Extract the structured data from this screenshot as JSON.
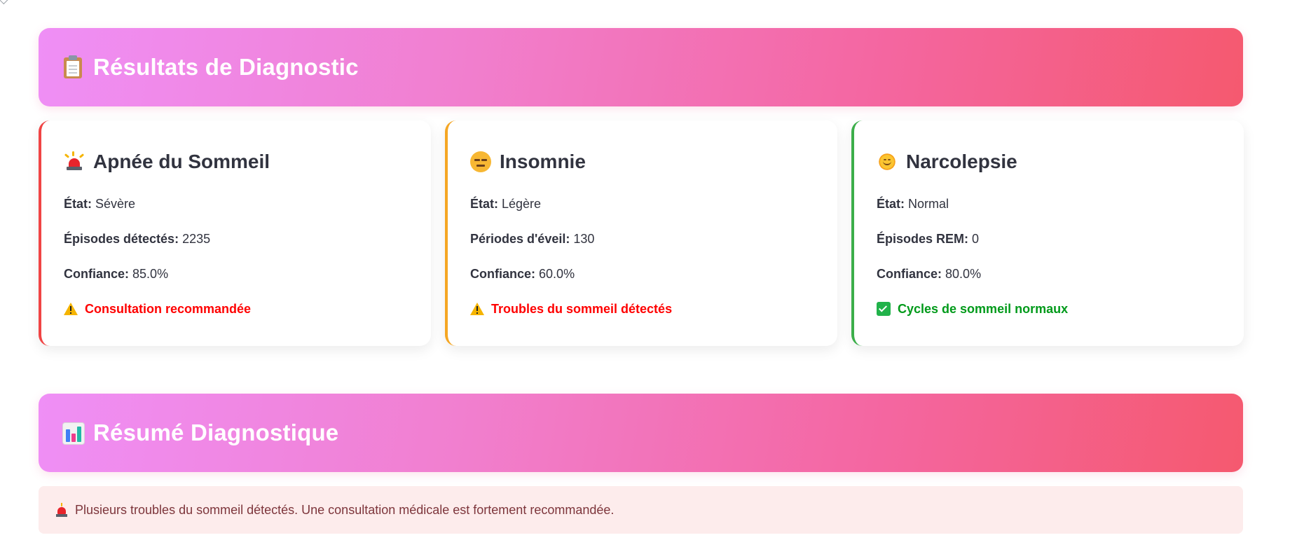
{
  "results_banner": {
    "title": "Résultats de Diagnostic",
    "icon": "clipboard-icon"
  },
  "cards": [
    {
      "icon": "siren-icon",
      "title": "Apnée du Sommeil",
      "accent": "#f04444",
      "rows": [
        {
          "label": "État:",
          "value": "Sévère"
        },
        {
          "label": "Épisodes détectés:",
          "value": "2235"
        },
        {
          "label": "Confiance:",
          "value": "85.0%"
        }
      ],
      "alert": {
        "icon": "warning-icon",
        "text": "Consultation recommandée",
        "color": "#ff0000"
      }
    },
    {
      "icon": "expressionless-face-icon",
      "title": "Insomnie",
      "accent": "#f5a623",
      "rows": [
        {
          "label": "État:",
          "value": "Légère"
        },
        {
          "label": "Périodes d'éveil:",
          "value": "130"
        },
        {
          "label": "Confiance:",
          "value": "60.0%"
        }
      ],
      "alert": {
        "icon": "warning-icon",
        "text": "Troubles du sommeil détectés",
        "color": "#ff0000"
      }
    },
    {
      "icon": "sun-face-icon",
      "title": "Narcolepsie",
      "accent": "#3cae4a",
      "rows": [
        {
          "label": "État:",
          "value": "Normal"
        },
        {
          "label": "Épisodes REM:",
          "value": "0"
        },
        {
          "label": "Confiance:",
          "value": "80.0%"
        }
      ],
      "alert": {
        "icon": "check-icon",
        "text": "Cycles de sommeil normaux",
        "color": "#009a1a"
      }
    }
  ],
  "summary_banner": {
    "title": "Résumé Diagnostique",
    "icon": "bar-chart-icon"
  },
  "summary_message": {
    "icon": "siren-icon",
    "text": "Plusieurs troubles du sommeil détectés. Une consultation médicale est fortement recommandée."
  },
  "colors": {
    "banner_gradient_start": "#ef8ff6",
    "banner_gradient_end": "#f5596f",
    "alert_background": "#fdecec",
    "alert_text": "#7d353b"
  }
}
